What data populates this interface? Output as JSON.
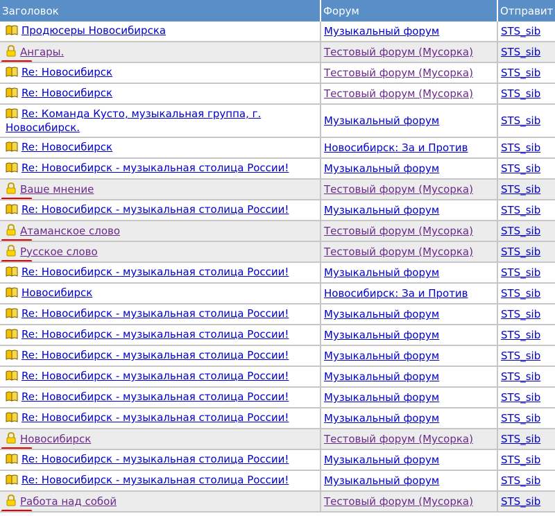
{
  "header": {
    "col_title": "Заголовок",
    "col_forum": "Форум",
    "col_sender": "Отправит"
  },
  "icons": {
    "book": "book-icon",
    "lock": "lock-icon"
  },
  "colors": {
    "header_bg": "#5a8ec7",
    "link": "#0000cc",
    "visited": "#6a2a8a",
    "mark": "#e30000"
  },
  "rows": [
    {
      "icon": "book",
      "title": "Продюсеры Новосибирска",
      "forum": "Музыкальный форум",
      "sender": "STS_sib"
    },
    {
      "icon": "lock",
      "title": "Ангары.",
      "forum": "Тестовый форум (Мусорка)",
      "sender": "STS_sib"
    },
    {
      "icon": "book",
      "title": "Re: Новосибирск",
      "forum": "Тестовый форум (Мусорка)",
      "sender": "STS_sib"
    },
    {
      "icon": "book",
      "title": "Re: Новосибирск",
      "forum": "Тестовый форум (Мусорка)",
      "sender": "STS_sib"
    },
    {
      "icon": "book",
      "title": "Re: Команда Кусто, музыкальная группа, г. Новосибирск.",
      "forum": "Музыкальный форум",
      "sender": "STS_sib"
    },
    {
      "icon": "book",
      "title": "Re: Новосибирск",
      "forum": "Новосибирск: За и Против",
      "sender": "STS_sib"
    },
    {
      "icon": "book",
      "title": "Re: Новосибирск - музыкальная столица России!",
      "forum": "Музыкальный форум",
      "sender": "STS_sib"
    },
    {
      "icon": "lock",
      "title": "Ваше мнение",
      "forum": "Тестовый форум (Мусорка)",
      "sender": "STS_sib"
    },
    {
      "icon": "book",
      "title": "Re: Новосибирск - музыкальная столица России!",
      "forum": "Музыкальный форум",
      "sender": "STS_sib"
    },
    {
      "icon": "lock",
      "title": "Атаманское слово",
      "forum": "Тестовый форум (Мусорка)",
      "sender": "STS_sib"
    },
    {
      "icon": "lock",
      "title": "Русское слово",
      "forum": "Тестовый форум (Мусорка)",
      "sender": "STS_sib"
    },
    {
      "icon": "book",
      "title": "Re: Новосибирск - музыкальная столица России!",
      "forum": "Музыкальный форум",
      "sender": "STS_sib"
    },
    {
      "icon": "book",
      "title": "Новосибирск",
      "forum": "Новосибирск: За и Против",
      "sender": "STS_sib"
    },
    {
      "icon": "book",
      "title": "Re: Новосибирск - музыкальная столица России!",
      "forum": "Музыкальный форум",
      "sender": "STS_sib"
    },
    {
      "icon": "book",
      "title": "Re: Новосибирск - музыкальная столица России!",
      "forum": "Музыкальный форум",
      "sender": "STS_sib"
    },
    {
      "icon": "book",
      "title": "Re: Новосибирск - музыкальная столица России!",
      "forum": "Музыкальный форум",
      "sender": "STS_sib"
    },
    {
      "icon": "book",
      "title": "Re: Новосибирск - музыкальная столица России!",
      "forum": "Музыкальный форум",
      "sender": "STS_sib"
    },
    {
      "icon": "book",
      "title": "Re: Новосибирск - музыкальная столица России!",
      "forum": "Музыкальный форум",
      "sender": "STS_sib"
    },
    {
      "icon": "book",
      "title": "Re: Новосибирск - музыкальная столица России!",
      "forum": "Музыкальный форум",
      "sender": "STS_sib"
    },
    {
      "icon": "lock",
      "title": "Новосибирск",
      "forum": "Тестовый форум (Мусорка)",
      "sender": "STS_sib"
    },
    {
      "icon": "book",
      "title": "Re: Новосибирск - музыкальная столица России!",
      "forum": "Музыкальный форум",
      "sender": "STS_sib"
    },
    {
      "icon": "book",
      "title": "Re: Новосибирск - музыкальная столица России!",
      "forum": "Музыкальный форум",
      "sender": "STS_sib"
    },
    {
      "icon": "lock",
      "title": "Работа над собой",
      "forum": "Тестовый форум (Мусорка)",
      "sender": "STS_sib"
    }
  ]
}
